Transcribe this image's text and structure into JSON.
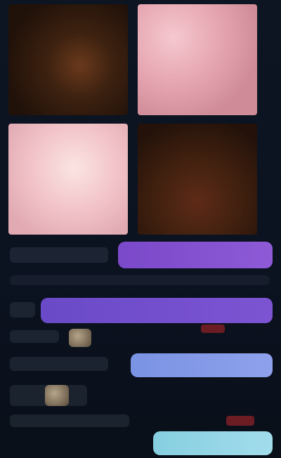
{
  "gallery": {
    "tiles": [
      {
        "icon": "image-icon",
        "tone": "dark"
      },
      {
        "icon": "image-icon",
        "tone": "pink"
      },
      {
        "icon": "image-icon",
        "tone": "pink"
      },
      {
        "icon": "image-icon",
        "tone": "dark"
      }
    ]
  },
  "messages": {
    "bubble_1": "",
    "bubble_2": "",
    "bubble_3": "",
    "bubble_4": ""
  },
  "colors": {
    "background": "#0c1320",
    "bubble_purple": "#8e5ad6",
    "bubble_violet": "#7c54d2",
    "bubble_blue": "#8ea1ec",
    "bubble_cyan": "#a2dcec"
  }
}
